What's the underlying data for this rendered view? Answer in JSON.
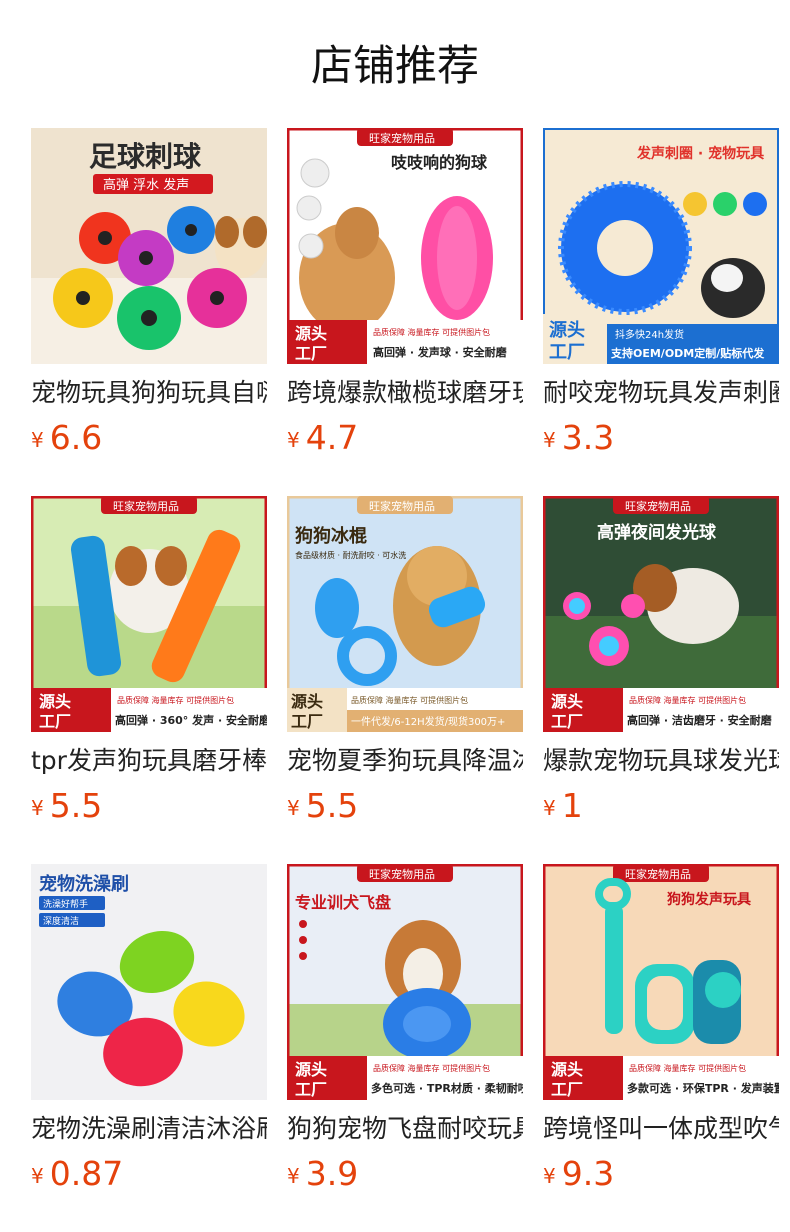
{
  "page_title": "店铺推荐",
  "currency_symbol": "¥",
  "products": [
    {
      "name": "宠物玩具狗狗玩具自嗨",
      "price": "6.6",
      "image_text": [
        "足球刺球",
        "高弹 浮水 发声"
      ]
    },
    {
      "name": "跨境爆款橄榄球磨牙玩具",
      "price": "4.7",
      "image_text": [
        "旺家宠物用品",
        "吱吱响的狗球",
        "源头工厂",
        "品质保障 海量库存 可提供图片包",
        "高回弹 · 发声球 · 安全耐磨"
      ]
    },
    {
      "name": "耐咬宠物玩具发声刺圈",
      "price": "3.3",
      "image_text": [
        "发声刺圈 · 宠物玩具",
        "源头工厂",
        "抖多快24h发货",
        "支持OEM/ODM定制/贴标代发"
      ]
    },
    {
      "name": "tpr发声狗玩具磨牙棒",
      "price": "5.5",
      "image_text": [
        "旺家宠物用品",
        "源头工厂",
        "品质保障 海量库存 可提供图片包",
        "高回弹 · 360° 发声 · 安全耐磨"
      ]
    },
    {
      "name": "宠物夏季狗玩具降温冰棍",
      "price": "5.5",
      "image_text": [
        "旺家宠物用品",
        "狗狗冰棍",
        "食品级材质 · 耐洗耐咬 · 可水洗",
        "源头工厂",
        "品质保障 海量库存 可提供图片包",
        "一件代发/6-12H发货/现货300万+"
      ]
    },
    {
      "name": "爆款宠物玩具球发光球",
      "price": "1",
      "image_text": [
        "旺家宠物用品",
        "高弹夜间发光球",
        "源头工厂",
        "品质保障 海量库存 可提供图片包",
        "高回弹 · 洁齿磨牙 · 安全耐磨"
      ]
    },
    {
      "name": "宠物洗澡刷清洁沐浴刷",
      "price": "0.87",
      "image_text": [
        "宠物洗澡刷",
        "洗澡好帮手",
        "深度清洁"
      ]
    },
    {
      "name": "狗狗宠物飞盘耐咬玩具",
      "price": "3.9",
      "image_text": [
        "旺家宠物用品",
        "专业训犬飞盘",
        "源头工厂",
        "品质保障 海量库存 可提供图片包",
        "多色可选 · TPR材质 · 柔韧耐咬"
      ]
    },
    {
      "name": "跨境怪叫一体成型吹气",
      "price": "9.3",
      "image_text": [
        "旺家宠物用品",
        "狗狗发声玩具",
        "源头工厂",
        "品质保障 海量库存 可提供图片包",
        "多款可选 · 环保TPR · 发声装置"
      ]
    }
  ],
  "colors": {
    "price": "#e4420c",
    "banner_red": "#c8161d",
    "title": "#111111"
  }
}
